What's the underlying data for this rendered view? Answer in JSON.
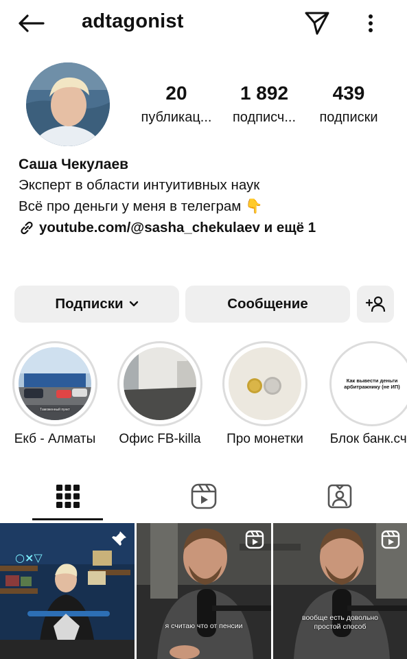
{
  "header": {
    "username": "adtagonist"
  },
  "profile": {
    "stats": [
      {
        "value": "20",
        "label": "публикац..."
      },
      {
        "value": "1 892",
        "label": "подписч..."
      },
      {
        "value": "439",
        "label": "подписки"
      }
    ],
    "name": "Саша Чекулаев",
    "bio_line1": "Эксперт в области интуитивных наук",
    "bio_line2": "Всё про деньги у меня в телеграм 👇",
    "link": "youtube.com/@sasha_chekulaev и ещё 1"
  },
  "actions": {
    "follow_label": "Подписки",
    "message_label": "Сообщение"
  },
  "highlights": [
    {
      "label": "Екб - Алматы",
      "inner_text": "Таможенный пункт"
    },
    {
      "label": "Офис FB-killa"
    },
    {
      "label": "Про монетки"
    },
    {
      "label": "Блок банк.сче",
      "inner_text": "Как вывести деньги арбитражнику (не ИП)"
    }
  ],
  "tabs": [
    {
      "name": "grid",
      "icon": "grid-icon",
      "active": true
    },
    {
      "name": "reels",
      "icon": "reels-icon",
      "active": false
    },
    {
      "name": "tagged",
      "icon": "tagged-icon",
      "active": false
    }
  ],
  "posts": [
    {
      "type": "pinned",
      "icon": "pin-icon",
      "caption": ""
    },
    {
      "type": "reel",
      "icon": "reel-icon",
      "caption": "я считаю что от пенсии"
    },
    {
      "type": "reel",
      "icon": "reel-icon",
      "caption": "вообще есть довольно простой способ"
    }
  ],
  "colors": {
    "button_bg": "#efefef",
    "text": "#111111",
    "highlight_ring": "#dcdcdc"
  }
}
